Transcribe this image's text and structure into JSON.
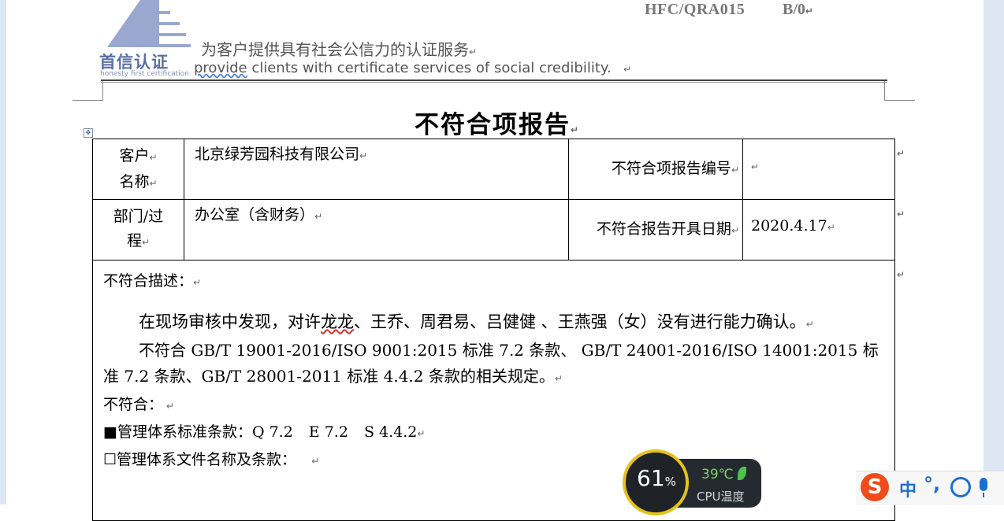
{
  "header": {
    "doc_code": "HFC/QRA015",
    "doc_rev": "B/0",
    "logo_text": "首信认证",
    "logo_sub": "honesty first  certification",
    "slogan_cn": "为客户提供具有社会公信力的认证服务",
    "slogan_en_pre": "provide",
    "slogan_en_rest": " clients with certificate services of social credibility."
  },
  "title": "不符合项报告",
  "table": {
    "customer_label_1": "客户",
    "customer_label_2": "名称",
    "customer_value": "北京绿芳园科技有限公司",
    "report_no_label": "不符合项报告编号",
    "report_no_value": "",
    "dept_label_1": "部门/过",
    "dept_label_2": "程",
    "dept_value": "办公室（含财务）",
    "date_label": "不符合报告开具日期",
    "date_value": "2020.4.17"
  },
  "description": {
    "label": "不符合描述：",
    "para1_a": "在现场审核中发现，对许",
    "para1_wavy": "龙龙",
    "para1_b": "、王乔、周君易、吕健健 、王燕强（女）没有进行能力确认。",
    "para2": "不符合 GB/T 19001-2016/ISO 9001:2015 标准 7.2 条款、 GB/T 24001-2016/ISO 14001:2015 标准 7.2 条款、GB/T 28001-2011 标准 4.4.2 条款的相关规定。",
    "nonconform_label": "不符合：",
    "clause_check": "■",
    "clause_text": "管理体系标准条款：Q 7.2",
    "clause_e": "E 7.2",
    "clause_s": "S 4.4.2",
    "doc_check": "☐",
    "doc_text": "管理体系文件名称及条款："
  },
  "cpu_widget": {
    "percent": "61",
    "percent_sign": "%",
    "temperature": "39℃",
    "label": "CPU温度"
  },
  "ime_bar": {
    "logo": "S",
    "mode": "中",
    "punct": "°,",
    "colors": {
      "accent": "#1c6fd1",
      "logo": "#f04b1a"
    }
  },
  "colors": {
    "ring": "#e6c21a",
    "temp": "#7fd06a"
  }
}
